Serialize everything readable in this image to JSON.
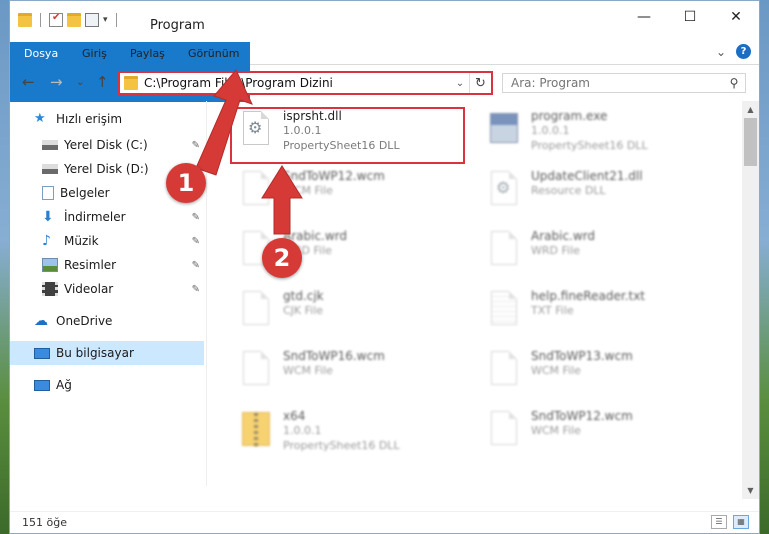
{
  "window": {
    "title": "Program",
    "controls": {
      "minimize": "—",
      "maximize": "☐",
      "close": "✕"
    }
  },
  "ribbon": {
    "tabs": [
      "Dosya",
      "Giriş",
      "Paylaş",
      "Görünüm"
    ],
    "expand_glyph": "⌄",
    "help_glyph": "?"
  },
  "nav": {
    "back_glyph": "←",
    "forward_glyph": "→",
    "recent_glyph": "⌄",
    "up_glyph": "↑",
    "address": "C:\\Program Files\\Program Dizini",
    "address_drop_glyph": "⌄",
    "refresh_glyph": "↻",
    "search_placeholder": "Ara: Program",
    "search_glyph": "⚲"
  },
  "sidebar": {
    "items": [
      {
        "label": "Hızlı erişim",
        "icon": "star-icon",
        "pinned": false
      },
      {
        "label": "Yerel Disk (C:)",
        "icon": "drive-icon",
        "pinned": true
      },
      {
        "label": "Yerel Disk (D:)",
        "icon": "drive-icon",
        "pinned": true
      },
      {
        "label": "Belgeler",
        "icon": "documents-icon",
        "pinned": true
      },
      {
        "label": "İndirmeler",
        "icon": "download-icon",
        "pinned": true
      },
      {
        "label": "Müzik",
        "icon": "music-icon",
        "pinned": true
      },
      {
        "label": "Resimler",
        "icon": "pictures-icon",
        "pinned": true
      },
      {
        "label": "Videolar",
        "icon": "video-icon",
        "pinned": true
      },
      {
        "label": "OneDrive",
        "icon": "cloud-icon",
        "pinned": false
      },
      {
        "label": "Bu bilgisayar",
        "icon": "computer-icon",
        "pinned": false,
        "selected": true
      },
      {
        "label": "Ağ",
        "icon": "network-icon",
        "pinned": false
      }
    ],
    "pin_glyph": "📌"
  },
  "files": [
    {
      "name": "isprsht.dll",
      "line1": "1.0.0.1",
      "line2": "PropertySheet16 DLL",
      "icon": "gear-file-icon",
      "highlighted": true
    },
    {
      "name": "program.exe",
      "line1": "1.0.0.1",
      "line2": "PropertySheet16 DLL",
      "icon": "exe-icon"
    },
    {
      "name": "SndToWP12.wcm",
      "line1": "WCM File",
      "icon": "file-icon"
    },
    {
      "name": "UpdateClient21.dll",
      "line1": "Resource DLL",
      "icon": "gear-file-icon"
    },
    {
      "name": "Arabic.wrd",
      "line1": "WRD File",
      "icon": "file-icon"
    },
    {
      "name": "Arabic.wrd",
      "line1": "WRD File",
      "icon": "file-icon"
    },
    {
      "name": "gtd.cjk",
      "line1": "CJK File",
      "icon": "file-icon"
    },
    {
      "name": "help.fineReader.txt",
      "line1": "TXT File",
      "icon": "text-file-icon"
    },
    {
      "name": "SndToWP16.wcm",
      "line1": "WCM File",
      "icon": "file-icon"
    },
    {
      "name": "SndToWP13.wcm",
      "line1": "WCM File",
      "icon": "file-icon"
    },
    {
      "name": "x64",
      "line1": "1.0.0.1",
      "line2": "PropertySheet16 DLL",
      "icon": "zip-folder-icon"
    },
    {
      "name": "SndToWP12.wcm",
      "line1": "WCM File",
      "icon": "file-icon"
    }
  ],
  "status": {
    "count": "151 öğe"
  },
  "callouts": [
    "1",
    "2"
  ],
  "colors": {
    "accent": "#1979ca",
    "highlight": "#d9333f",
    "callout": "#d63a37",
    "selected": "#cce8ff"
  }
}
